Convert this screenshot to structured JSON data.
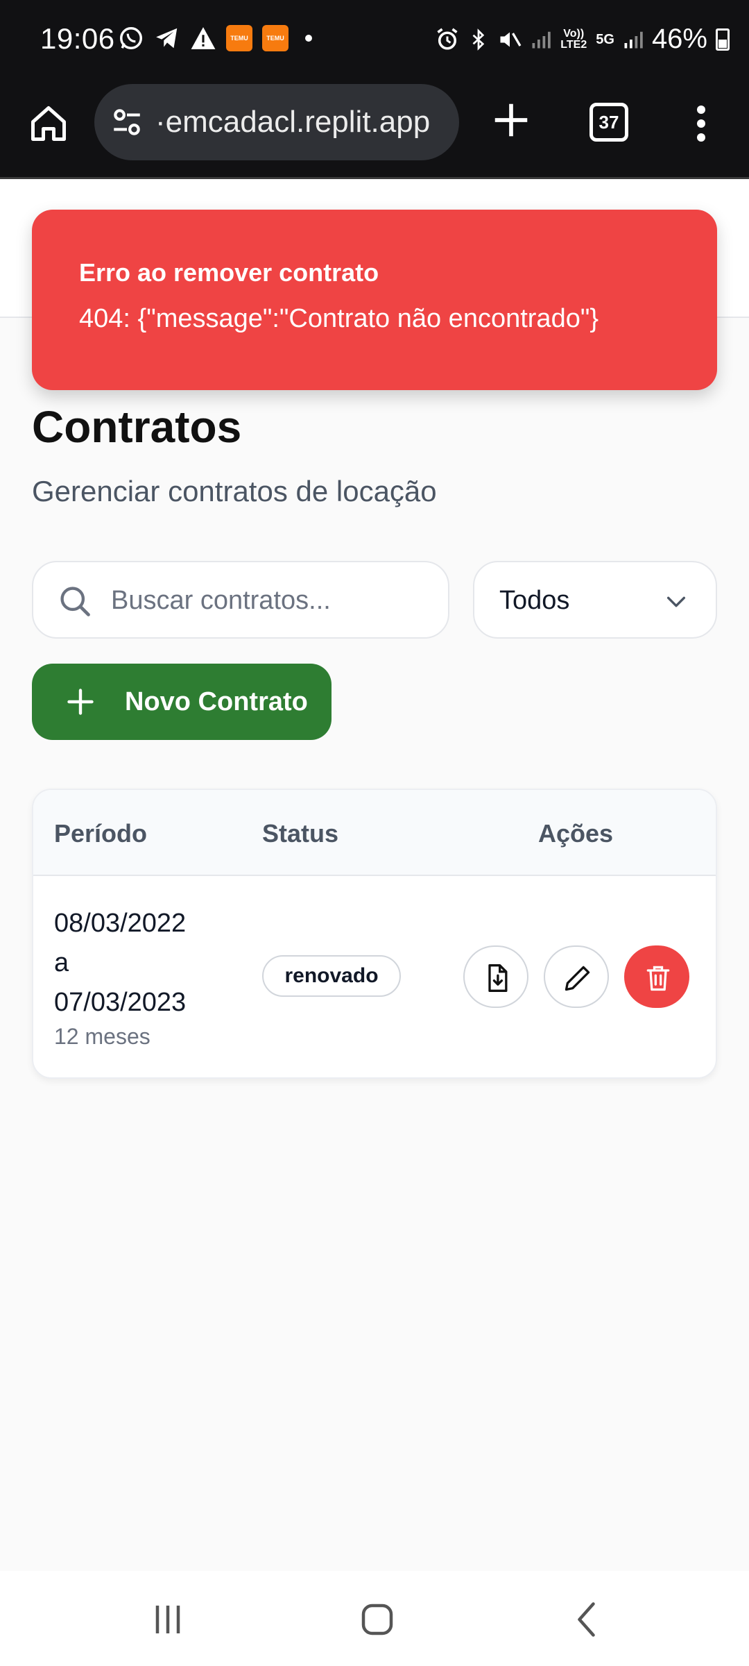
{
  "status_bar": {
    "time": "19:06",
    "left_icons": [
      "whatsapp-icon",
      "telegram-icon",
      "warning-icon",
      "temu-icon",
      "temu-icon",
      "dot-icon"
    ],
    "temu_label": "TEMU",
    "volte_label": "Vo)) LTE2",
    "network_label": "5G",
    "battery_percent": "46%"
  },
  "browser": {
    "url": "·emcadacl.replit.app",
    "tab_count": "37"
  },
  "toast": {
    "title": "Erro ao remover contrato",
    "message": "404: {\"message\":\"Contrato não encontrado\"}",
    "color": "#ef4444"
  },
  "page": {
    "title": "Contratos",
    "subtitle": "Gerenciar contratos de locação"
  },
  "search": {
    "placeholder": "Buscar contratos...",
    "value": ""
  },
  "filter": {
    "selected": "Todos"
  },
  "new_button": {
    "label": "Novo Contrato",
    "color": "#2e7d32"
  },
  "table": {
    "columns": [
      "Período",
      "Status",
      "Ações"
    ],
    "rows": [
      {
        "period_start": "08/03/2022",
        "period_sep": "a",
        "period_end": "07/03/2023",
        "duration": "12 meses",
        "status": "renovado",
        "actions": [
          "file-download-icon",
          "pencil-icon",
          "trash-icon"
        ]
      }
    ]
  }
}
